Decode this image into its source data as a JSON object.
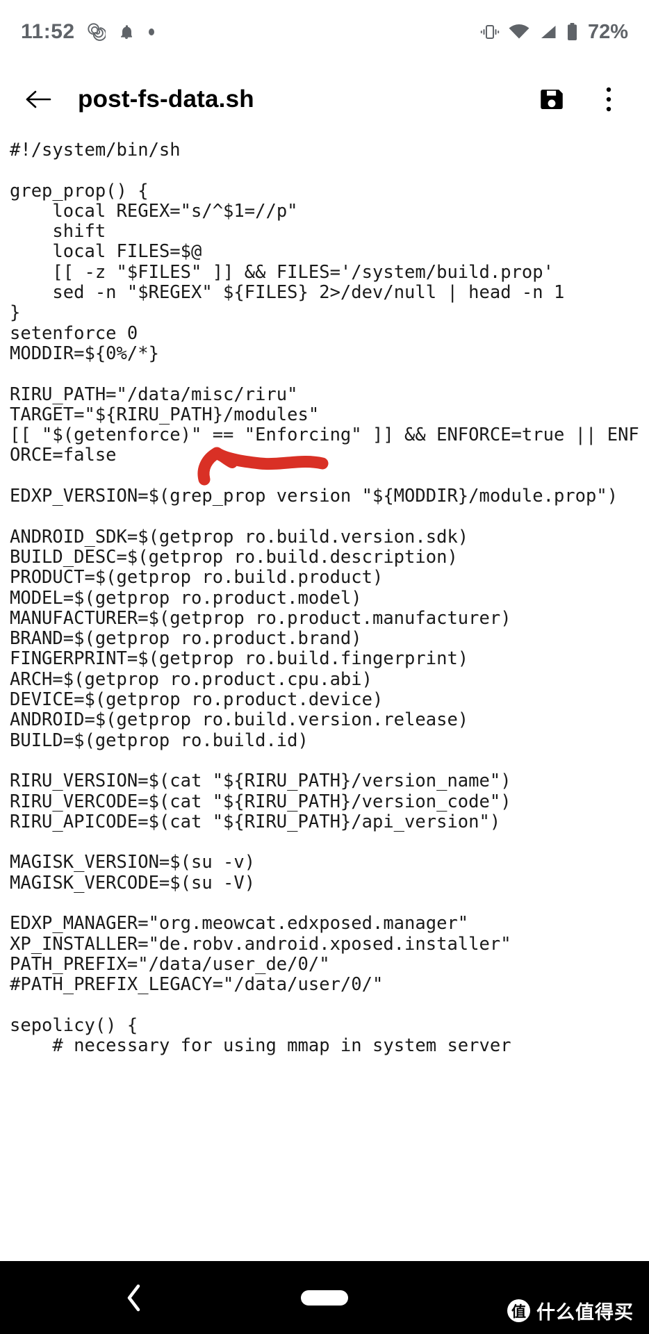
{
  "status_bar": {
    "time": "11:52",
    "battery_percent": "72%",
    "icons": [
      "spiral-icon",
      "bell-icon",
      "dot-icon",
      "vibrate-icon",
      "wifi-icon",
      "signal-icon",
      "battery-icon"
    ]
  },
  "app_bar": {
    "back_label": "back-arrow",
    "title": "post-fs-data.sh",
    "save_label": "save-icon",
    "overflow_label": "more-vert-icon"
  },
  "editor": {
    "content": "#!/system/bin/sh\n\ngrep_prop() {\n    local REGEX=\"s/^$1=//p\"\n    shift\n    local FILES=$@\n    [[ -z \"$FILES\" ]] && FILES='/system/build.prop'\n    sed -n \"$REGEX\" ${FILES} 2>/dev/null | head -n 1\n}\nsetenforce 0\nMODDIR=${0%/*}\n\nRIRU_PATH=\"/data/misc/riru\"\nTARGET=\"${RIRU_PATH}/modules\"\n[[ \"$(getenforce)\" == \"Enforcing\" ]] && ENFORCE=true || ENFORCE=false\n\nEDXP_VERSION=$(grep_prop version \"${MODDIR}/module.prop\")\n\nANDROID_SDK=$(getprop ro.build.version.sdk)\nBUILD_DESC=$(getprop ro.build.description)\nPRODUCT=$(getprop ro.build.product)\nMODEL=$(getprop ro.product.model)\nMANUFACTURER=$(getprop ro.product.manufacturer)\nBRAND=$(getprop ro.product.brand)\nFINGERPRINT=$(getprop ro.build.fingerprint)\nARCH=$(getprop ro.product.cpu.abi)\nDEVICE=$(getprop ro.product.device)\nANDROID=$(getprop ro.build.version.release)\nBUILD=$(getprop ro.build.id)\n\nRIRU_VERSION=$(cat \"${RIRU_PATH}/version_name\")\nRIRU_VERCODE=$(cat \"${RIRU_PATH}/version_code\")\nRIRU_APICODE=$(cat \"${RIRU_PATH}/api_version\")\n\nMAGISK_VERSION=$(su -v)\nMAGISK_VERCODE=$(su -V)\n\nEDXP_MANAGER=\"org.meowcat.edxposed.manager\"\nXP_INSTALLER=\"de.robv.android.xposed.installer\"\nPATH_PREFIX=\"/data/user_de/0/\"\n#PATH_PREFIX_LEGACY=\"/data/user/0/\"\n\nsepolicy() {\n    # necessary for using mmap in system server"
  },
  "annotation": {
    "shape": "red-left-arrow",
    "color": "#d93025",
    "points_at": "setenforce 0"
  },
  "nav_bar": {
    "back_label": "nav-back-chevron",
    "home_label": "nav-home-pill",
    "watermark_logo": "值",
    "watermark_text": "什么值得买"
  }
}
